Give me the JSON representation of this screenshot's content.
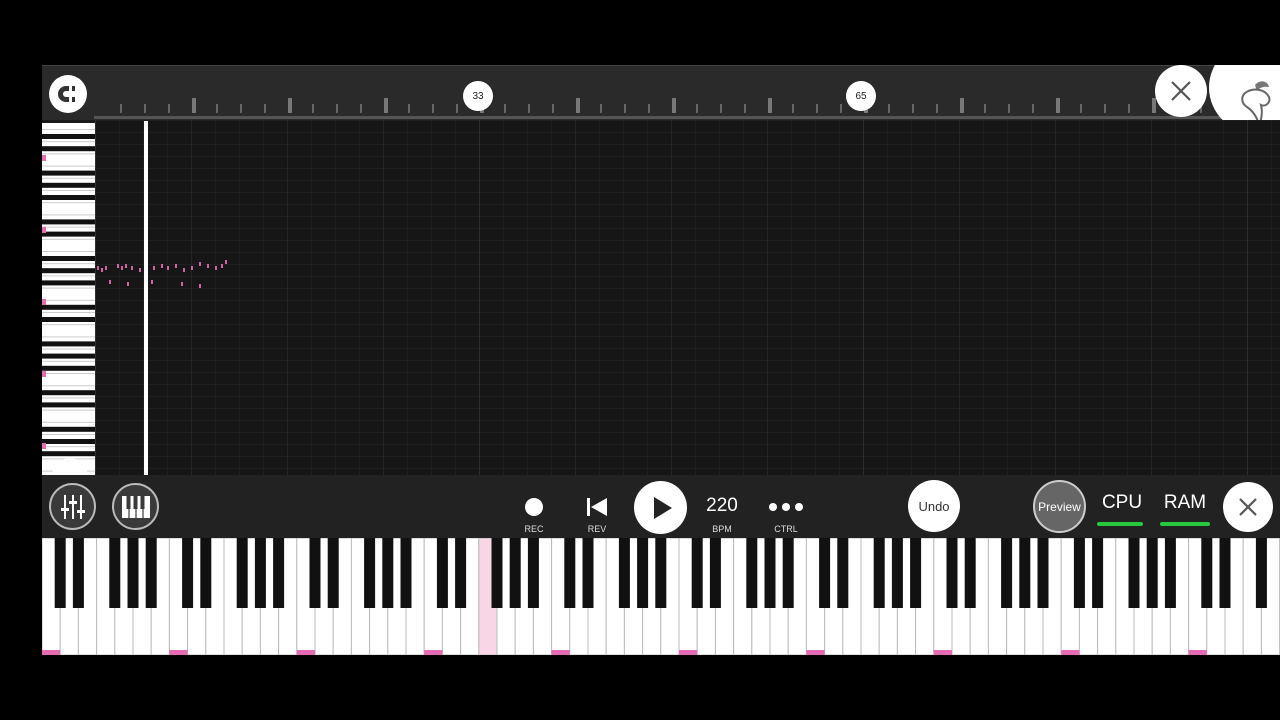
{
  "ruler": {
    "bar_markers": [
      "33",
      "65"
    ]
  },
  "transport": {
    "rec_label": "REC",
    "rev_label": "REV",
    "bpm_value": "220",
    "bpm_label": "BPM",
    "ctrl_label": "CTRL",
    "undo_label": "Undo",
    "preview_label": "Preview",
    "cpu_label": "CPU",
    "ram_label": "RAM"
  },
  "colors": {
    "accent_pink": "#e66bb4",
    "meter_green": "#27c93f",
    "background": "#191919"
  },
  "icons": {
    "snap": "magnet-icon",
    "close": "close-icon",
    "logo": "fl-fruit-logo-icon",
    "back": "chevron-left-icon",
    "mixer": "mixer-sliders-icon",
    "keys": "piano-keys-icon",
    "rec": "record-dot-icon",
    "rev": "skip-back-icon",
    "play": "play-icon",
    "ctrl": "more-dots-icon"
  }
}
